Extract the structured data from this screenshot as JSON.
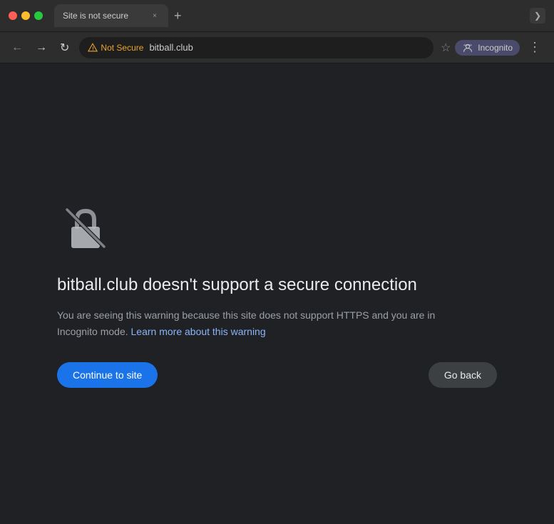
{
  "titlebar": {
    "traffic_lights": {
      "close_label": "close",
      "minimize_label": "minimize",
      "maximize_label": "maximize"
    },
    "tab": {
      "title": "Site is not secure",
      "close_icon": "×"
    },
    "new_tab_icon": "+",
    "expand_icon": "❯"
  },
  "addressbar": {
    "back_icon": "←",
    "forward_icon": "→",
    "reload_icon": "↻",
    "not_secure_label": "Not Secure",
    "address": "bitball.club",
    "bookmark_icon": "☆",
    "incognito_label": "Incognito",
    "incognito_icon": "🕵",
    "menu_icon": "⋮"
  },
  "main": {
    "error_title": "bitball.club doesn't support a secure connection",
    "error_description_1": "You are seeing this warning because this site does not support HTTPS and you are in Incognito mode. ",
    "learn_more_link": "Learn more about this warning",
    "continue_button_label": "Continue to site",
    "goback_button_label": "Go back"
  },
  "colors": {
    "accent_blue": "#1a73e8",
    "link_blue": "#8ab4f8",
    "warning_yellow": "#e8a52a",
    "bg_dark": "#202124",
    "text_primary": "#e8eaed",
    "text_secondary": "#9aa0a6"
  }
}
